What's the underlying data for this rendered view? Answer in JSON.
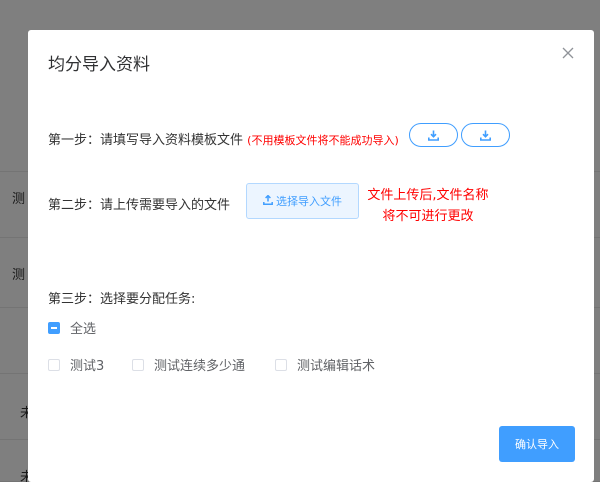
{
  "background": {
    "rows": [
      {
        "left": "测",
        "right": ""
      },
      {
        "left": "测",
        "right": ""
      },
      {
        "left": "",
        "right": ""
      },
      {
        "left": "未",
        "right": ""
      },
      {
        "left": "未",
        "right": ""
      }
    ]
  },
  "modal": {
    "title": "均分导入资料",
    "step1": {
      "label": "第一步：请填写导入资料模板文件",
      "warning": "(不用模板文件将不能成功导入)",
      "download_icon": "download-icon"
    },
    "step2": {
      "label": "第二步：请上传需要导入的文件",
      "upload_label": "选择导入文件",
      "upload_icon": "upload-icon",
      "note_line1": "文件上传后,文件名称",
      "note_line2": "将不可进行更改"
    },
    "step3": {
      "label": "第三步：选择要分配任务:",
      "select_all": "全选",
      "tasks": [
        "测试3",
        "测试连续多少通",
        "测试编辑话术"
      ]
    },
    "confirm_label": "确认导入",
    "close_icon": "close-icon"
  },
  "colors": {
    "primary": "#409eff",
    "warning_text": "#ff0000",
    "overlay": "rgba(0,0,0,0.5)"
  }
}
